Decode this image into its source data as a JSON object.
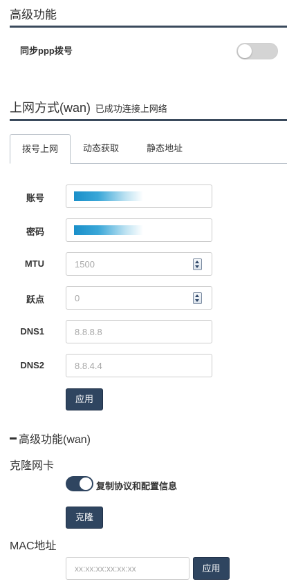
{
  "advanced": {
    "title": "高级功能",
    "sync_label": "同步ppp拨号",
    "sync_enabled": false
  },
  "wan": {
    "title": "上网方式(wan)",
    "status": "已成功连接上网络",
    "tabs": [
      {
        "label": "拨号上网",
        "active": true
      },
      {
        "label": "动态获取",
        "active": false
      },
      {
        "label": "静态地址",
        "active": false
      }
    ],
    "fields": {
      "account_label": "账号",
      "password_label": "密码",
      "mtu_label": "MTU",
      "mtu_placeholder": "1500",
      "hop_label": "跃点",
      "hop_placeholder": "0",
      "dns1_label": "DNS1",
      "dns1_placeholder": "8.8.8.8",
      "dns2_label": "DNS2",
      "dns2_placeholder": "8.8.4.4"
    },
    "apply_label": "应用"
  },
  "wan_advanced": {
    "title": "高级功能(wan)",
    "clone_title": "克隆网卡",
    "clone_toggle_label": "复制协议和配置信息",
    "clone_enabled": true,
    "clone_button": "克隆",
    "mac_title": "MAC地址",
    "mac_placeholder": "xx:xx:xx:xx:xx:xx",
    "mac_apply": "应用"
  },
  "colors": {
    "primary": "#2f4560",
    "rule": "#3a4a5c",
    "mask": "#1a8fc9"
  }
}
